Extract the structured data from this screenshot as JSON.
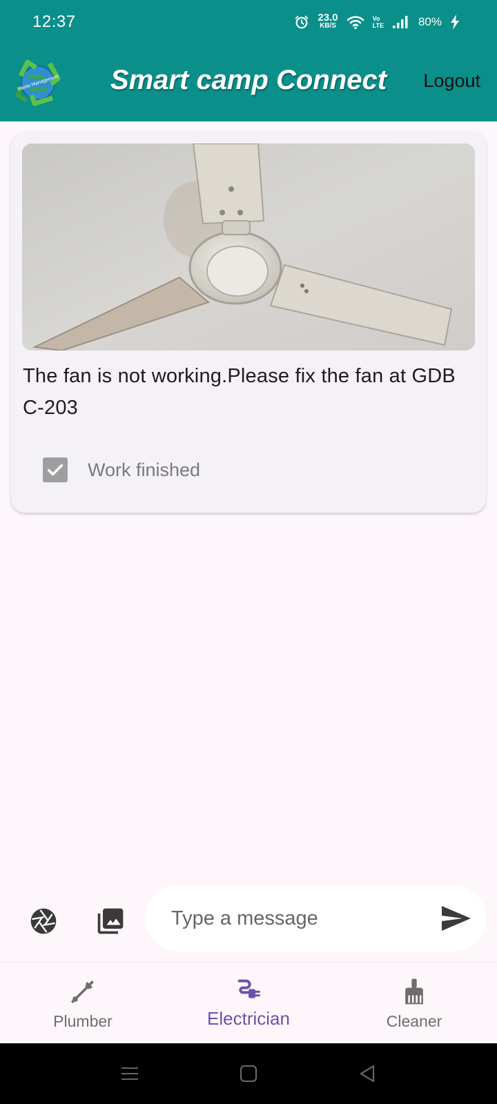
{
  "status_bar": {
    "time": "12:37",
    "net_speed_value": "23.0",
    "net_speed_unit": "KB/S",
    "volte_top": "Vo",
    "volte_bottom": "LTE",
    "battery": "80%"
  },
  "app_bar": {
    "title": "Smart camp Connect",
    "logout_label": "Logout",
    "logo_text": "Waste Management",
    "background_color": "#0a8f8a"
  },
  "card": {
    "description": "The fan is not working.Please fix the fan at GDB C-203",
    "checkbox_label": "Work finished",
    "checkbox_checked": true
  },
  "composer": {
    "placeholder": "Type a message",
    "camera_icon": "camera-shutter-icon",
    "gallery_icon": "photo-library-icon",
    "send_icon": "send-icon"
  },
  "bottom_nav": {
    "items": [
      {
        "label": "Plumber",
        "icon": "plumbing-icon",
        "active": false
      },
      {
        "label": "Electrician",
        "icon": "electrical-plug-icon",
        "active": true
      },
      {
        "label": "Cleaner",
        "icon": "cleaning-brush-icon",
        "active": false
      }
    ],
    "active_color": "#6a52a8"
  }
}
